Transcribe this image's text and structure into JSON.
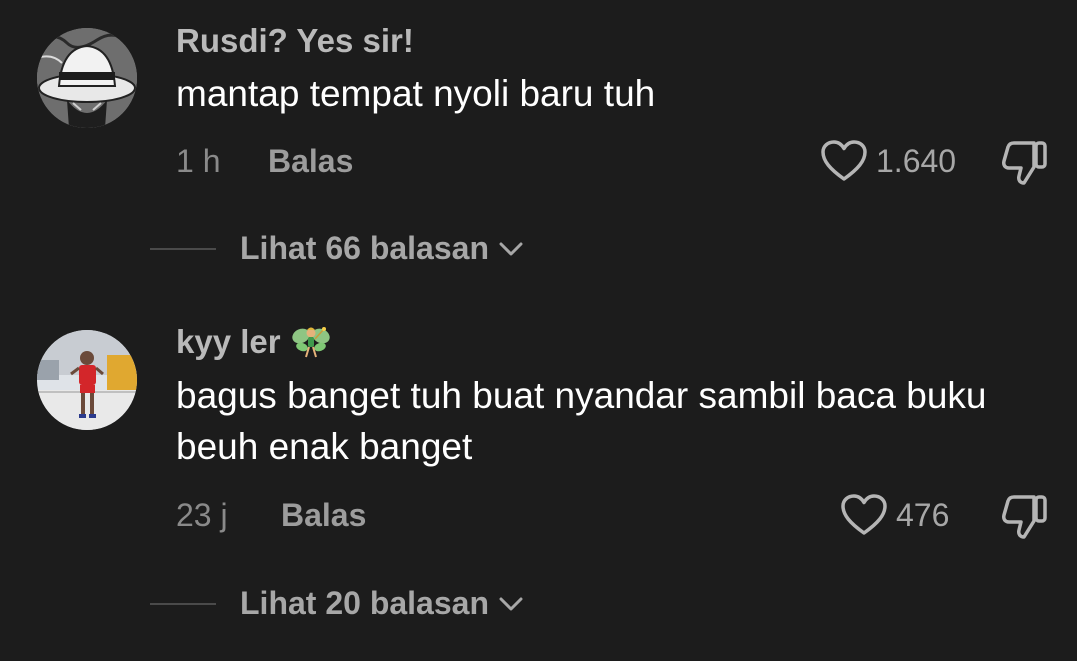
{
  "comments": [
    {
      "username": "Rusdi? Yes sir!",
      "avatar_icon": "straw-hat-anime-avatar",
      "text": "mantap tempat nyoli baru tuh",
      "time": "1 h",
      "reply_label": "Balas",
      "like_count": "1.640",
      "view_replies_label": "Lihat 66 balasan"
    },
    {
      "username": "kyy ler",
      "username_badge_icon": "fairy-emoji",
      "avatar_icon": "person-on-court-avatar",
      "text": "bagus banget tuh buat nyandar sambil baca buku beuh enak banget",
      "time": "23 j",
      "reply_label": "Balas",
      "like_count": "476",
      "view_replies_label": "Lihat 20 balasan"
    }
  ],
  "colors": {
    "background": "#1c1c1c",
    "username": "#b9b9b9",
    "text": "#ffffff",
    "meta": "#8a8a8a",
    "secondary": "#a7a7a7"
  }
}
